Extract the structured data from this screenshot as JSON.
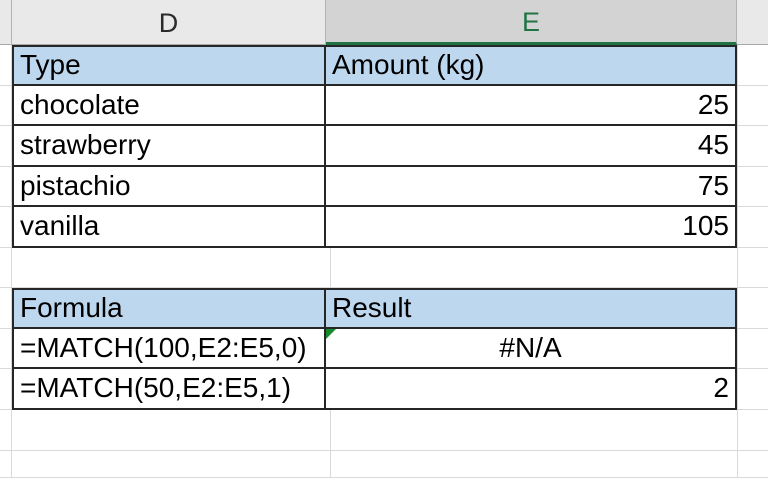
{
  "app": "spreadsheet-grid",
  "column_headers": {
    "d": "D",
    "e": "E"
  },
  "selected_column": "E",
  "cells": {
    "D1": "Type",
    "E1": "Amount (kg)",
    "D2": "chocolate",
    "E2": "25",
    "D3": "strawberry",
    "E3": "45",
    "D4": "pistachio",
    "E4": "75",
    "D5": "vanilla",
    "E5": "105",
    "D7": "Formula",
    "E7": "Result",
    "D8": "=MATCH(100,E2:E5,0)",
    "E8": "#N/A",
    "D9": "=MATCH(50,E2:E5,1)",
    "E9": "2"
  },
  "colors": {
    "accent_green": "#217346",
    "table_header_fill": "#bdd7ee",
    "selected_column_header_bg": "#d3d3d3",
    "column_header_bg": "#e9e9e9",
    "error_indicator_green": "#178a2c",
    "table_border": "#262626",
    "gridline": "#d9d9d9"
  }
}
